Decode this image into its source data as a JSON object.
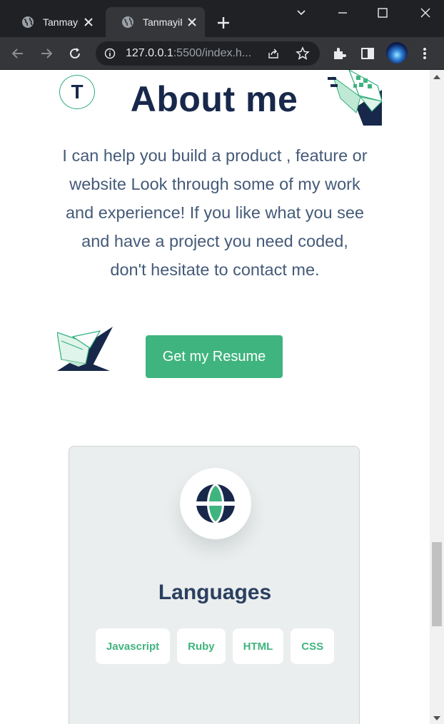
{
  "browser": {
    "tabs": [
      {
        "title": "TanmayiP",
        "active": false
      },
      {
        "title": "TanmayiP",
        "active": true
      }
    ],
    "url_host": "127.0.0.1",
    "url_rest": ":5500/index.h...",
    "colors": {
      "frame": "#202124",
      "toolbar": "#35363a",
      "omnibox": "#202124"
    }
  },
  "page": {
    "logo_letter": "T",
    "heading": "About me",
    "about_text": "I can help you build a product , feature or website Look through some of my work and experience! If you like what you see and have a project you need coded, don't hesitate to contact me.",
    "resume_button": "Get my Resume",
    "card": {
      "title": "Languages",
      "icon": "globe-icon",
      "chips": [
        "Javascript",
        "Ruby",
        "HTML",
        "CSS"
      ]
    },
    "colors": {
      "accent": "#3fb47e",
      "heading": "#18284b",
      "body_text": "#445a78",
      "card_bg": "#ebeeee"
    }
  }
}
